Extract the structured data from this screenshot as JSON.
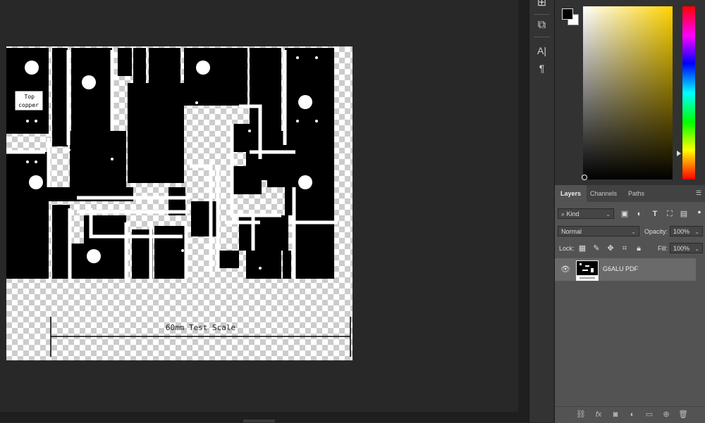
{
  "document": {
    "scale_label": "60mm Test Scale",
    "silk_text": [
      "Top",
      "copper"
    ]
  },
  "tool_strip": {
    "tools": [
      {
        "name": "history-icon",
        "glyph": "⊞"
      },
      {
        "name": "properties-icon",
        "glyph": "⧉"
      },
      {
        "name": "character-icon",
        "glyph": "A|"
      },
      {
        "name": "paragraph-icon",
        "glyph": "¶"
      }
    ]
  },
  "color_panel": {
    "foreground": "#000000",
    "background": "#ffffff"
  },
  "layers_panel": {
    "tabs": [
      "Layers",
      "Channels",
      "Paths"
    ],
    "active_tab": "Layers",
    "filter": {
      "label": "Kind",
      "icon": "search-icon"
    },
    "blend_mode": "Normal",
    "opacity_label": "Opacity:",
    "opacity_value": "100%",
    "lock_label": "Lock:",
    "fill_label": "Fill:",
    "fill_value": "100%",
    "layers": [
      {
        "name": "G6ALU PDF",
        "visible": true
      }
    ],
    "footer_icons": [
      "link-icon",
      "fx-icon",
      "mask-icon",
      "adjustment-icon",
      "group-folder-icon",
      "new-layer-icon",
      "trash-icon"
    ]
  }
}
